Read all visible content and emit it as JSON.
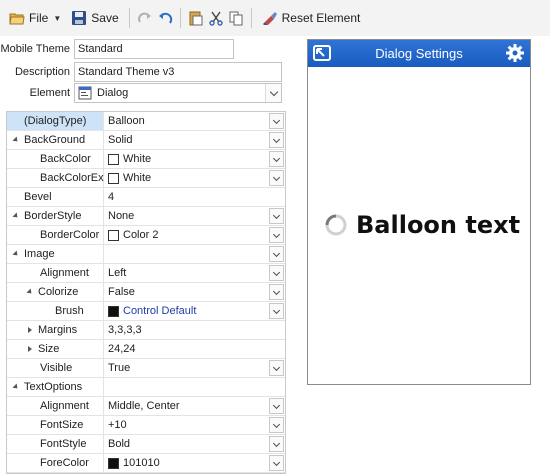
{
  "toolbar": {
    "file_label": "File",
    "save_label": "Save",
    "reset_label": "Reset Element"
  },
  "form": {
    "theme_label": "Mobile Theme",
    "theme_value": "Standard",
    "description_label": "Description",
    "description_value": "Standard Theme v3",
    "element_label": "Element",
    "element_value": "Dialog"
  },
  "grid": {
    "rows": [
      {
        "name": "(DialogType)",
        "value": "Balloon"
      },
      {
        "name": "BackGround",
        "value": "Solid"
      },
      {
        "name": "BackColor",
        "value": "White"
      },
      {
        "name": "BackColorEx",
        "value": "White"
      },
      {
        "name": "Bevel",
        "value": "4"
      },
      {
        "name": "BorderStyle",
        "value": "None"
      },
      {
        "name": "BorderColor",
        "value": "Color 2"
      },
      {
        "name": "Image",
        "value": ""
      },
      {
        "name": "Alignment",
        "value": "Left"
      },
      {
        "name": "Colorize",
        "value": "False"
      },
      {
        "name": "Brush",
        "value": "Control Default"
      },
      {
        "name": "Margins",
        "value": "3,3,3,3"
      },
      {
        "name": "Size",
        "value": "24,24"
      },
      {
        "name": "Visible",
        "value": "True"
      },
      {
        "name": "TextOptions",
        "value": ""
      },
      {
        "name": "Alignment",
        "value": "Middle, Center"
      },
      {
        "name": "FontSize",
        "value": "+10"
      },
      {
        "name": "FontStyle",
        "value": "Bold"
      },
      {
        "name": "ForeColor",
        "value": "101010"
      }
    ]
  },
  "preview": {
    "title": "Dialog Settings",
    "balloon_text": "Balloon text"
  },
  "colors": {
    "header_blue": "#1f64c8",
    "brush_text": "#1e3ca8",
    "selected_row": "#cfe3f8",
    "forecolor": "#101010"
  }
}
